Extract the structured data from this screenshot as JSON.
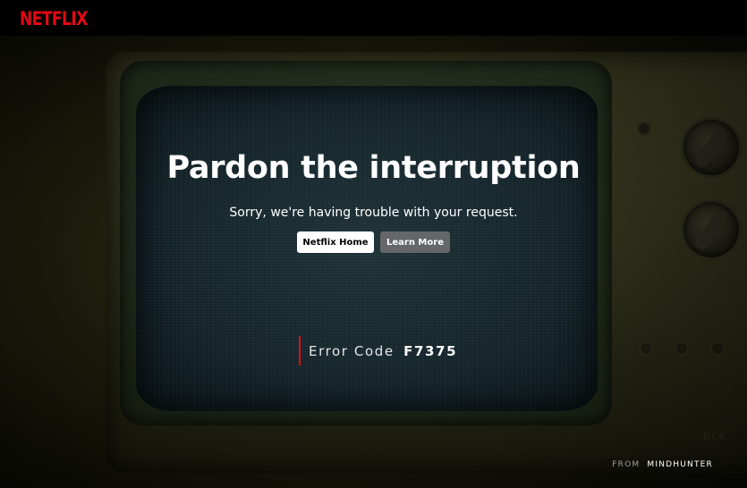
{
  "header": {
    "logo_text": "NETFLIX",
    "logo_color": "#e50914"
  },
  "main": {
    "title": "Pardon the interruption",
    "subtitle": "Sorry, we're having trouble with your request.",
    "buttons": {
      "home_label": "Netflix Home",
      "learn_label": "Learn More"
    },
    "error": {
      "label": "Error Code",
      "code": "F7375"
    }
  },
  "footer": {
    "from_label": "FROM",
    "from_title": "MINDHUNTER"
  },
  "background": {
    "brand_mark": "RCA"
  }
}
